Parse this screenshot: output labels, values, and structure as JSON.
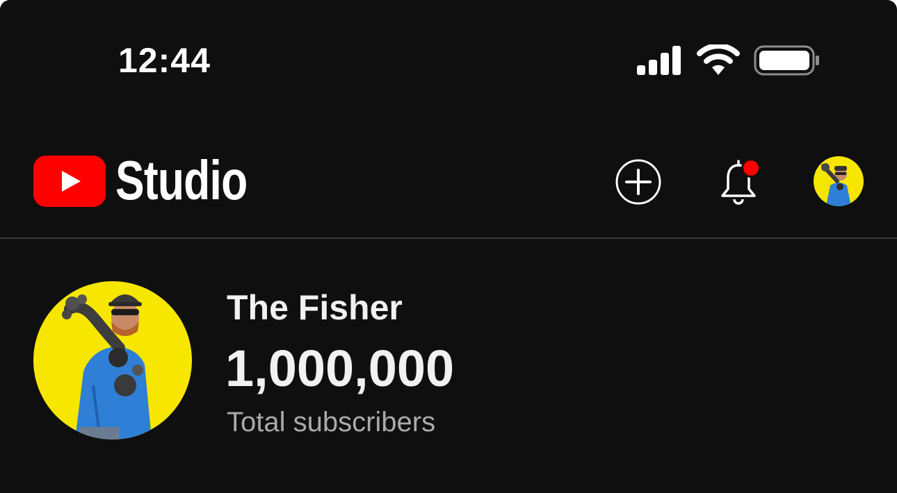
{
  "status_bar": {
    "time": "12:44",
    "icons": [
      "cellular-signal-icon",
      "wifi-icon",
      "battery-icon"
    ]
  },
  "header": {
    "logo_icon": "youtube-play-logo",
    "title": "Studio",
    "actions": [
      "create-plus-icon",
      "notification-bell-icon",
      "account-avatar"
    ],
    "notification_dot_color": "#ff0000"
  },
  "channel": {
    "name": "The Fisher",
    "subscriber_count": "1,000,000",
    "subscriber_label": "Total subscribers",
    "avatar_background": "#f7e600"
  },
  "colors": {
    "background": "#0f0f0f",
    "brand_red": "#ff0000",
    "text_primary": "#f1f1f1",
    "text_secondary": "#aaaaaa"
  }
}
